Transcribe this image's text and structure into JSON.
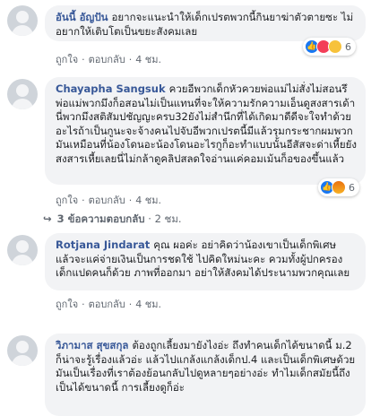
{
  "comments": [
    {
      "author": "อันนี้ อัญปัน",
      "text": "อยากจะแนะนำให้เด็กเปรตพวกนี้กินยาฆ่าตัวตายซะ ไม่อยากให้เติบโตเป็นขยะสังคมเลย",
      "actions": {
        "like": "ถูกใจ",
        "reply": "ตอบกลับ",
        "time": "4 ชม."
      },
      "reactions": {
        "icons": [
          "like-icon",
          "love-icon",
          "sad-icon"
        ],
        "count": "6"
      }
    },
    {
      "author": "Chayapha Sangsuk",
      "text": "ควยอีพวกเด็กหัวควยพ่อแม่ไม่สั่งไม่สอนรึพ่อแม่พวกมึงก็อสอนไม่เป็นแทนที่จะให้ความรักความเอ็นดูสงสารเด้านี่พวกมึงสติสัมปชัญญะครบ32ยังไม่สำนึกที่ได้เกิดมาดีดีจะใจทำด้วยอะไรถ้าเป็นกูนะจะจ้างคนไปจับอีพวกเปรตนี้มีแล้วรุมกระชากผมพวกมันเหมือนที่น้องโดนอะน้องโดนอะไรกูก็อะทำแบบนั้นอีสัสจะด่าเหี้ยยังสงสารเหี้ยเลยนี่ไม่กล้าดูคลิปสลดใจอ่านแค่คอมเม้นก็อของขึ้นแล้ว",
      "actions": {
        "like": "ถูกใจ",
        "reply": "ตอบกลับ",
        "time": "4 ชม."
      },
      "reactions": {
        "icons": [
          "like-icon",
          "angry-icon"
        ],
        "count": "6"
      }
    },
    {
      "author": "Rotjana Jindarat",
      "text": "คุณ ผอค่ะ อย่าคิดว่าน้องเขาเป็นเด็กพิเศษ แล้วจะแค่จ่ายเงินเป็นการชดใช้ ไปคิดใหม่นะคะ ควมทั้งผู้ปกครองเด็กแปดคนก็ด้วย ภาพที่ออกมา อย่าให้สังคมได้ประนามพวกคุณเลย",
      "actions": {
        "like": "ถูกใจ",
        "reply": "ตอบกลับ",
        "time": "4 ชม."
      }
    },
    {
      "author": "วิภามาส สุขสกุล",
      "text": "ต้องถูกเลี้ยงมายังไงอ่ะ ถึงทำคนเด็กได้ขนาดนี้ ม.2 ก็น่าจะรู้เรื่องแล้วอ่ะ แล้วไปแกล้งแกล้งเด็กป.4 และเป็นเด็กพิเศษด้วย มันเป็นเรื่องที่เราต้องย้อนกลับไปดูหลายๆอย่างอ่ะ ทำไมเด็กสมัยนี้ถึงเป็นได้ขนาดนี้ การเลี้ยงดูก็อ่ะ"
    }
  ],
  "replies_link": {
    "label": "3 ข้อความตอบกลับ",
    "time": "2 ชม."
  },
  "colors": {
    "author": "#385898",
    "bubble": "#f2f3f5",
    "meta": "#606770"
  }
}
